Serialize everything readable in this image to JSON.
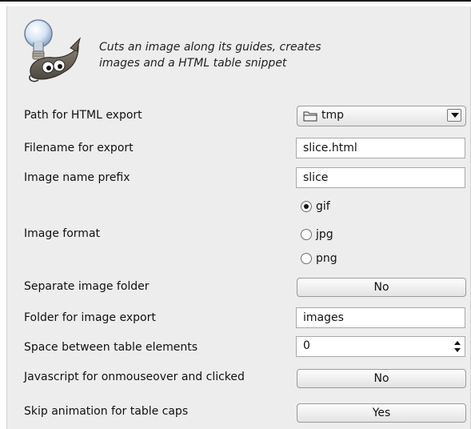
{
  "header": {
    "description_line1": "Cuts an image along its guides, creates",
    "description_line2": "images and a HTML table snippet",
    "icon": "wilber-lightbulb-icon"
  },
  "fields": {
    "path_label": "Path for HTML export",
    "path_value": "tmp",
    "filename_label": "Filename for export",
    "filename_value": "slice.html",
    "prefix_label": "Image name prefix",
    "prefix_value": "slice",
    "format_label": "Image format",
    "format_options": [
      "gif",
      "jpg",
      "png"
    ],
    "format_selected": "gif",
    "separate_label": "Separate image folder",
    "separate_value": "No",
    "folder_label": "Folder for image export",
    "folder_value": "images",
    "space_label": "Space between table elements",
    "space_value": "0",
    "js_label": "Javascript for onmouseover and clicked",
    "js_value": "No",
    "skip_label": "Skip animation for table caps",
    "skip_value": "Yes"
  }
}
